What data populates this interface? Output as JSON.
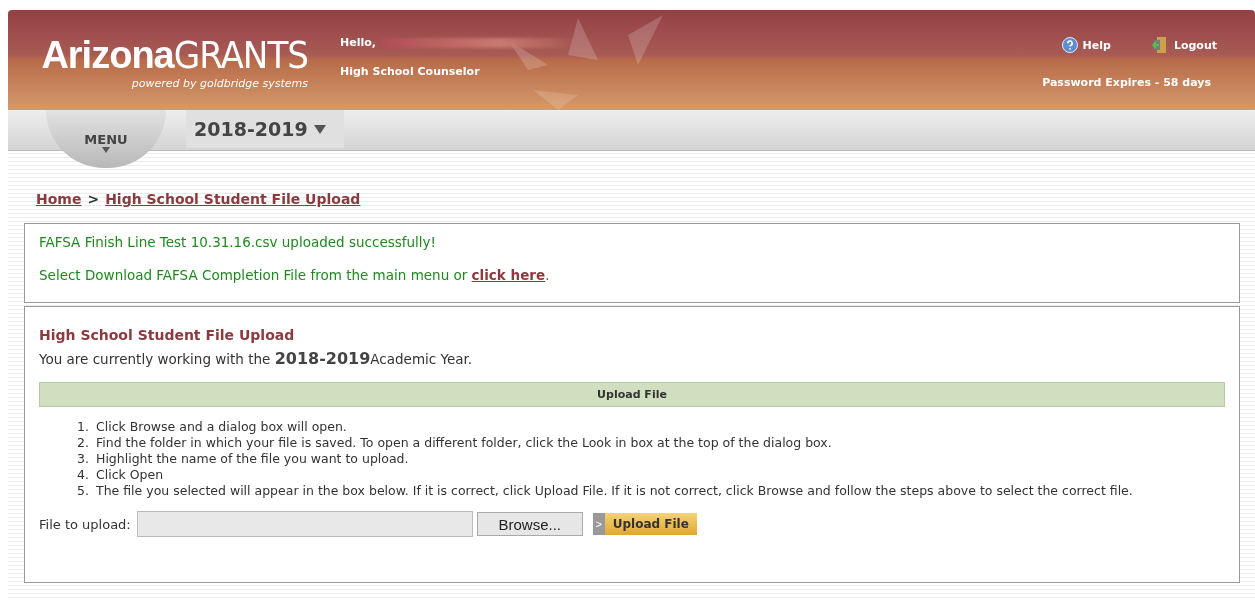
{
  "header": {
    "logo_bold": "Arizona",
    "logo_light": "GRANTS",
    "tagline": "powered by goldbridge systems",
    "greeting": "Hello,",
    "role": "High School Counselor",
    "help": "Help",
    "logout": "Logout",
    "password_notice": "Password Expires - 58 days"
  },
  "menu": {
    "label": "MENU",
    "year": "2018-2019"
  },
  "breadcrumb": [
    {
      "label": "Home"
    },
    {
      "label": "High School Student File Upload"
    }
  ],
  "breadcrumb_separator": ">",
  "message": {
    "line1": "FAFSA Finish Line Test 10.31.16.csv uploaded successfully!",
    "line2": "Select Download FAFSA Completion File from the main menu or",
    "link": "click here",
    "line2_end": "."
  },
  "section": {
    "title": "High School Student File Upload",
    "intro_before": "You are currently working with the",
    "intro_year": "2018-2019",
    "intro_after": "Academic Year.",
    "bar_title": "Upload File"
  },
  "steps": [
    {
      "number": "1.",
      "text": "Click Browse and a dialog box will open."
    },
    {
      "number": "2.",
      "text": "Find the folder in which your file is saved. To open a different folder, click the Look in box at the top of the dialog box."
    },
    {
      "number": "3.",
      "text": "Highlight the name of the file you want to upload."
    },
    {
      "number": "4.",
      "text": "Click Open"
    },
    {
      "number": "5.",
      "text": "The file you selected will appear in the box below. If it is correct, click Upload File. If it is not correct, click Browse and follow the steps above to select the correct file."
    }
  ],
  "upload": {
    "label": "File to upload:",
    "browse": "Browse...",
    "submit": "Upload File",
    "submit_arrow": ">"
  }
}
